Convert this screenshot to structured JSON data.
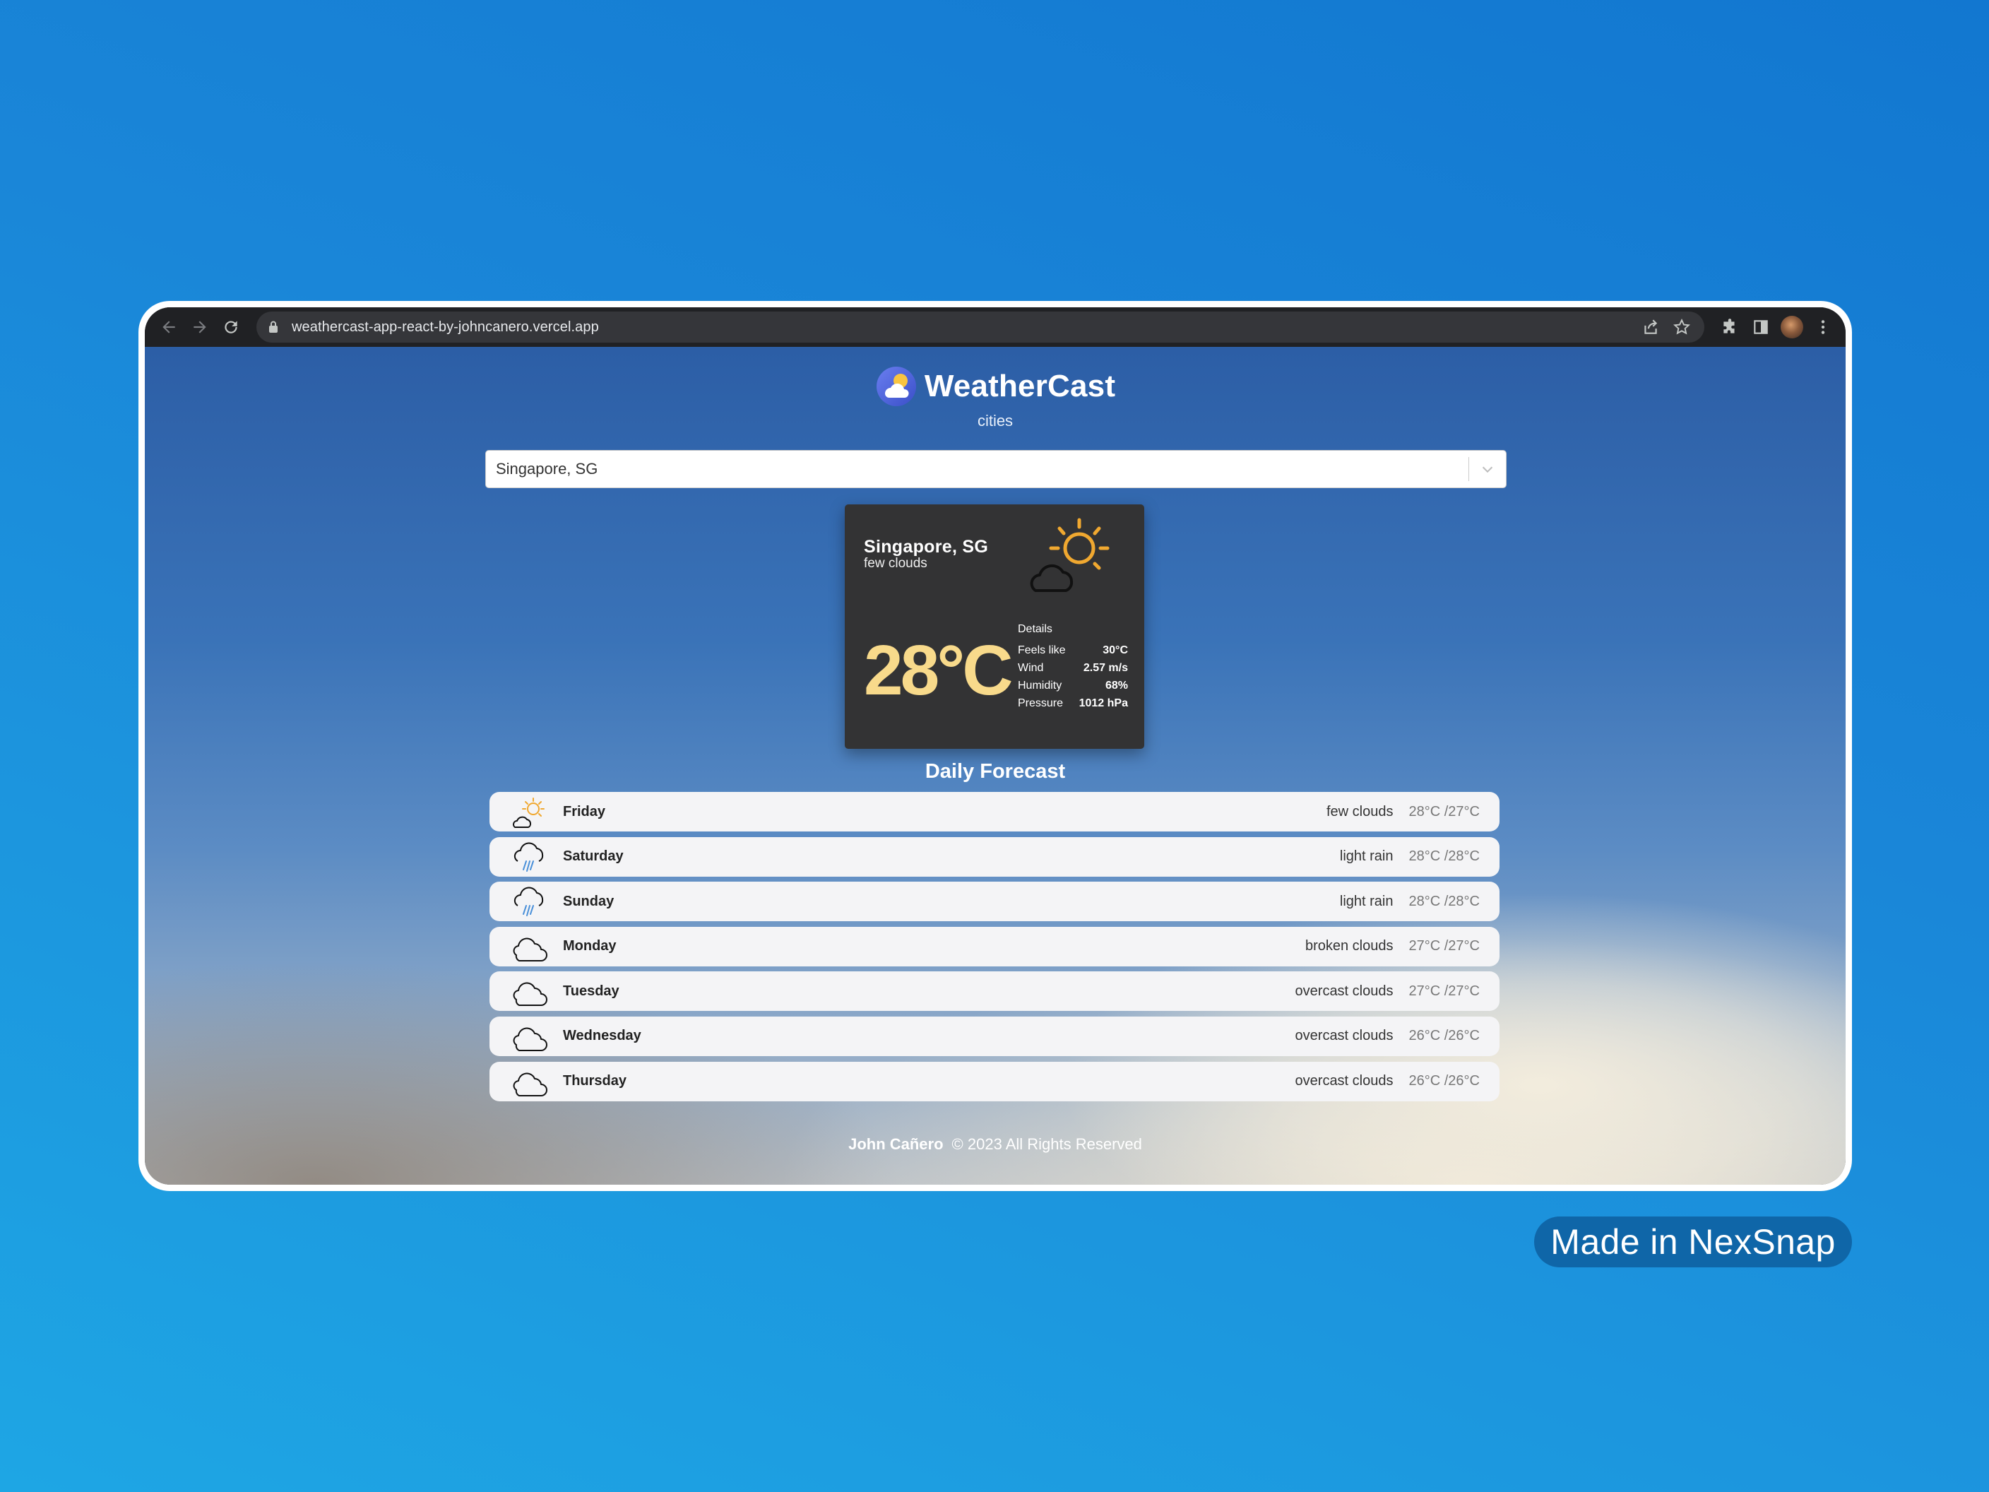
{
  "browser": {
    "url": "weathercast-app-react-by-johncanero.vercel.app"
  },
  "app": {
    "title": "WeatherCast",
    "subtitle": "cities"
  },
  "search": {
    "selected_value": "Singapore, SG"
  },
  "current": {
    "city": "Singapore, SG",
    "description": "few clouds",
    "temperature": "28°C",
    "details_title": "Details",
    "details": [
      {
        "label": "Feels like",
        "value": "30°C"
      },
      {
        "label": "Wind",
        "value": "2.57 m/s"
      },
      {
        "label": "Humidity",
        "value": "68%"
      },
      {
        "label": "Pressure",
        "value": "1012 hPa"
      }
    ],
    "icon": "sun-cloud-icon"
  },
  "forecast": {
    "title": "Daily Forecast",
    "days": [
      {
        "day": "Friday",
        "desc": "few clouds",
        "temp": "28°C /27°C",
        "icon": "sun-cloud-icon"
      },
      {
        "day": "Saturday",
        "desc": "light rain",
        "temp": "28°C /28°C",
        "icon": "rain-cloud-icon"
      },
      {
        "day": "Sunday",
        "desc": "light rain",
        "temp": "28°C /28°C",
        "icon": "rain-cloud-icon"
      },
      {
        "day": "Monday",
        "desc": "broken clouds",
        "temp": "27°C /27°C",
        "icon": "cloud-icon"
      },
      {
        "day": "Tuesday",
        "desc": "overcast clouds",
        "temp": "27°C /27°C",
        "icon": "cloud-icon"
      },
      {
        "day": "Wednesday",
        "desc": "overcast clouds",
        "temp": "26°C /26°C",
        "icon": "cloud-icon"
      },
      {
        "day": "Thursday",
        "desc": "overcast clouds",
        "temp": "26°C /26°C",
        "icon": "cloud-icon"
      }
    ]
  },
  "footer": {
    "name": "John Cañero",
    "rights": "© 2023 All Rights Reserved"
  },
  "badge": {
    "text": "Made in NexSnap"
  },
  "colors": {
    "temp_accent": "#f8da8b",
    "sun": "#f0a830",
    "rain": "#4a90d9"
  }
}
